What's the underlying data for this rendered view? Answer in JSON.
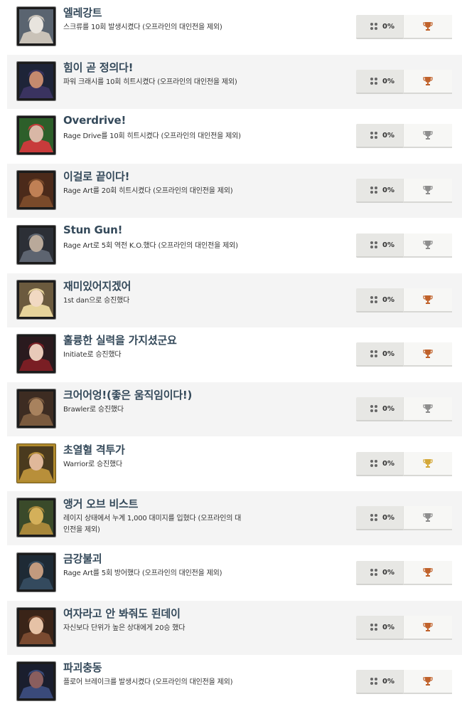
{
  "achievements": [
    {
      "title": "엘레강트",
      "desc": "스크류를 10회 발생시켰다 (오프라인의 대인전을 제외)",
      "percent": "0%",
      "trophy": "bronze",
      "thumb": "character-portrait-lars",
      "frame": "dark"
    },
    {
      "title": "힘이 곧 정의다!",
      "desc": "파워 크래시를 10회 히트시켰다 (오프라인의 대인전을 제외)",
      "percent": "0%",
      "trophy": "bronze",
      "thumb": "character-portrait-hooded",
      "frame": "dark"
    },
    {
      "title": "Overdrive!",
      "desc": "Rage Drive를 10회 히트시켰다 (오프라인의 대인전을 제외)",
      "percent": "0%",
      "trophy": "silver",
      "thumb": "character-portrait-gigas",
      "frame": "dark"
    },
    {
      "title": "이걸로 끝이다!",
      "desc": "Rage Art를 20회 히트시켰다 (오프라인의 대인전을 제외)",
      "percent": "0%",
      "trophy": "silver",
      "thumb": "character-portrait-miguel",
      "frame": "dark"
    },
    {
      "title": "Stun Gun!",
      "desc": "Rage Art로 5회 역전 K.O.했다 (오프라인의 대인전을 제외)",
      "percent": "0%",
      "trophy": "silver",
      "thumb": "character-portrait-hood",
      "frame": "dark"
    },
    {
      "title": "재미있어지겠어",
      "desc": "1st dan으로 승진했다",
      "percent": "0%",
      "trophy": "bronze",
      "thumb": "character-portrait-nina",
      "frame": "dark"
    },
    {
      "title": "훌륭한 실력을 가지셨군요",
      "desc": "Initiate로 승진했다",
      "percent": "0%",
      "trophy": "bronze",
      "thumb": "character-portrait-ling",
      "frame": "dark"
    },
    {
      "title": "크어어엉!(좋은 움직임이다!)",
      "desc": "Brawler로 승진했다",
      "percent": "0%",
      "trophy": "silver",
      "thumb": "character-portrait-kuma",
      "frame": "dark"
    },
    {
      "title": "초열혈 격투가",
      "desc": "Warrior로 승진했다",
      "percent": "0%",
      "trophy": "gold",
      "thumb": "character-portrait-paul",
      "frame": "gold"
    },
    {
      "title": "앵거 오브 비스트",
      "desc": "레이지 상태에서 누계 1,000 대미지를 입혔다 (오프라인의 대인전을 제외)",
      "percent": "0%",
      "trophy": "silver",
      "thumb": "character-portrait-king",
      "frame": "dark"
    },
    {
      "title": "금강불괴",
      "desc": "Rage Art를 5회 방어했다 (오프라인의 대인전을 제외)",
      "percent": "0%",
      "trophy": "bronze",
      "thumb": "character-portrait-kazuya",
      "frame": "dark"
    },
    {
      "title": "여자라고 안 봐줘도 된데이",
      "desc": "자신보다 단위가 높은 상대에게 20승 했다",
      "percent": "0%",
      "trophy": "bronze",
      "thumb": "character-portrait-josie",
      "frame": "dark"
    },
    {
      "title": "파괴충동",
      "desc": "플로어 브레이크를 발생시켰다 (오프라인의 대인전을 제외)",
      "percent": "0%",
      "trophy": "bronze",
      "thumb": "character-portrait-devil",
      "frame": "dark"
    }
  ],
  "colors": {
    "bronze": "#c0622b",
    "silver": "#8e8e8e",
    "gold": "#d4a838",
    "title": "#34495a"
  }
}
